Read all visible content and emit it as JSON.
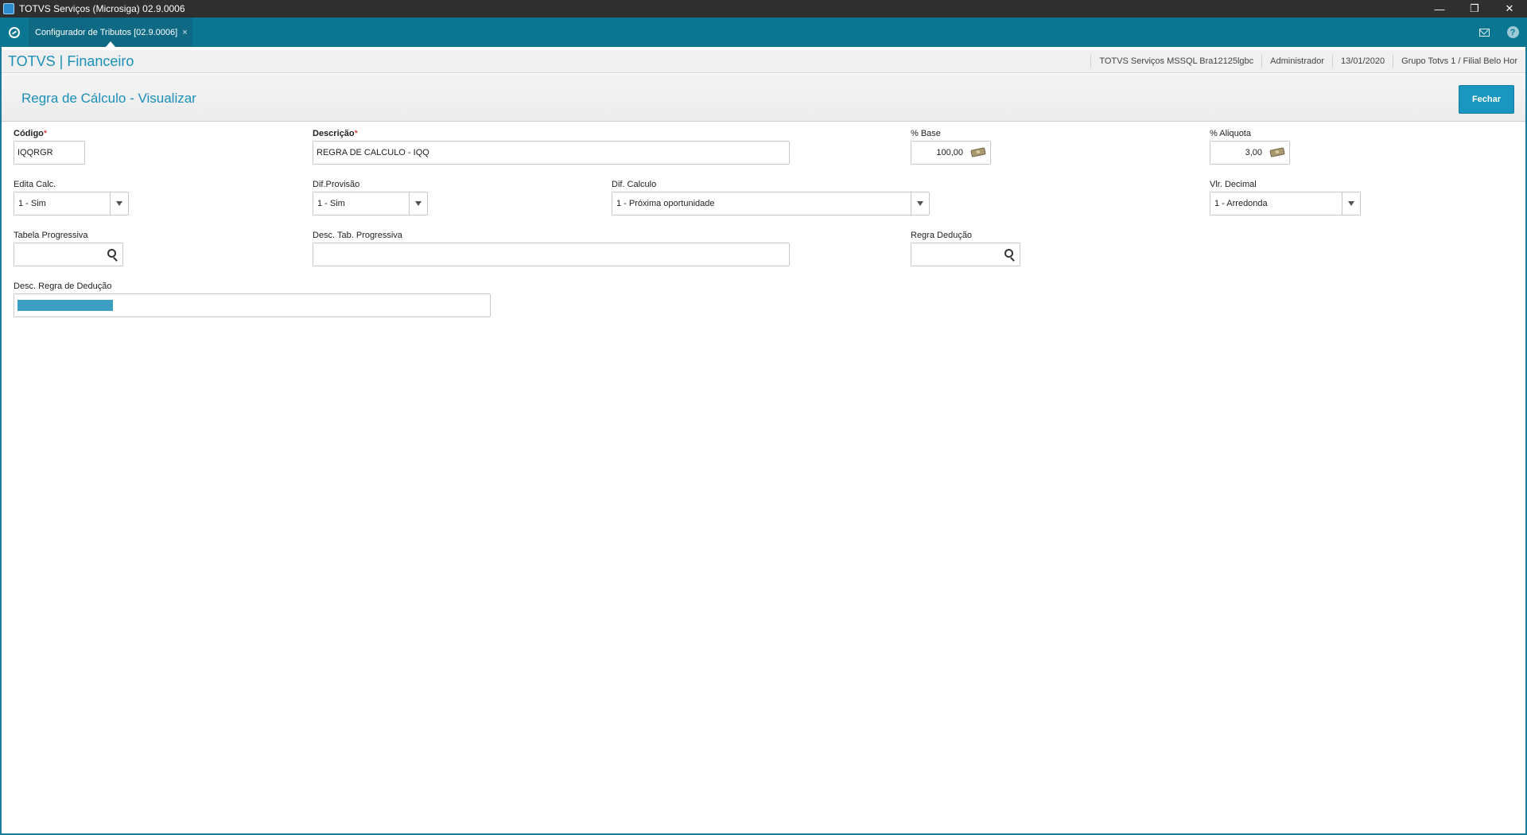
{
  "window": {
    "title": "TOTVS Serviços (Microsiga) 02.9.0006"
  },
  "tabs": [
    {
      "label": "Configurador de Tributos [02.9.0006]"
    }
  ],
  "header": {
    "brand": "TOTVS | Financeiro",
    "environment": "TOTVS Serviços MSSQL Bra12125lgbc",
    "user": "Administrador",
    "date": "13/01/2020",
    "branch": "Grupo Totvs 1 / Filial Belo Hor"
  },
  "page": {
    "title": "Regra de Cálculo - Visualizar",
    "close_label": "Fechar"
  },
  "form": {
    "codigo": {
      "label": "Código",
      "required_mark": "*",
      "value": "IQQRGR"
    },
    "descricao": {
      "label": "Descrição",
      "required_mark": "*",
      "value": "REGRA DE CALCULO - IQQ"
    },
    "base": {
      "label": "% Base",
      "value": "100,00"
    },
    "aliquota": {
      "label": "% Aliquota",
      "value": "3,00"
    },
    "edita_calc": {
      "label": "Edita Calc.",
      "value": "1 - Sim"
    },
    "dif_provisao": {
      "label": "Dif.Provisão",
      "value": "1 - Sim"
    },
    "dif_calculo": {
      "label": "Dif. Calculo",
      "value": "1 - Próxima oportunidade"
    },
    "vlr_decimal": {
      "label": "Vlr. Decimal",
      "value": "1 - Arredonda"
    },
    "tabela_progressiva": {
      "label": "Tabela Progressiva",
      "value": ""
    },
    "desc_tab_progressiva": {
      "label": "Desc. Tab. Progressiva",
      "value": ""
    },
    "regra_deducao": {
      "label": "Regra Dedução",
      "value": ""
    },
    "desc_regra_deducao": {
      "label": "Desc. Regra de Dedução",
      "value": ""
    }
  },
  "colors": {
    "accent": "#1a8fb8",
    "tabbar": "#0b7691",
    "button": "#1a97c0",
    "required": "#d10000"
  }
}
